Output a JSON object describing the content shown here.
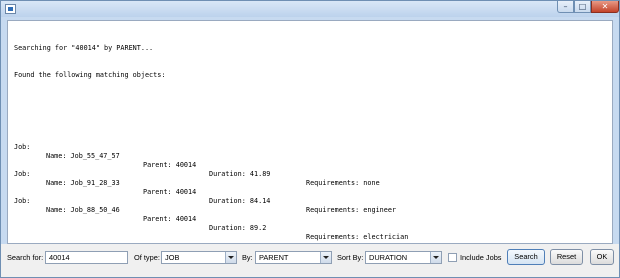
{
  "window": {
    "title": ""
  },
  "output": {
    "header": [
      "Searching for \"40014\" by PARENT...",
      "Found the following matching objects:"
    ],
    "results": [
      {
        "type": "Job:",
        "name": "Name: Job_55_47_57",
        "parent": "Parent: 40014",
        "duration": "Duration: 41.89",
        "requirements": "Requirements: none"
      },
      {
        "type": "Job:",
        "name": "Name: Job_91_28_33",
        "parent": "Parent: 40014",
        "duration": "Duration: 84.14",
        "requirements": "Requirements: engineer"
      },
      {
        "type": "Job:",
        "name": "Name: Job_88_50_46",
        "parent": "Parent: 40014",
        "duration": "Duration: 89.2",
        "requirements": "Requirements: electrician"
      }
    ]
  },
  "controls": {
    "search_for_label": "Search for:",
    "search_for_value": "40014",
    "of_type_label": "Of type:",
    "of_type_value": "JOB",
    "by_label": "By:",
    "by_value": "PARENT",
    "sort_by_label": "Sort By:",
    "sort_by_value": "DURATION",
    "include_jobs_label": "Include Jobs",
    "search_button": "Search",
    "reset_button": "Reset",
    "ok_button": "OK"
  }
}
